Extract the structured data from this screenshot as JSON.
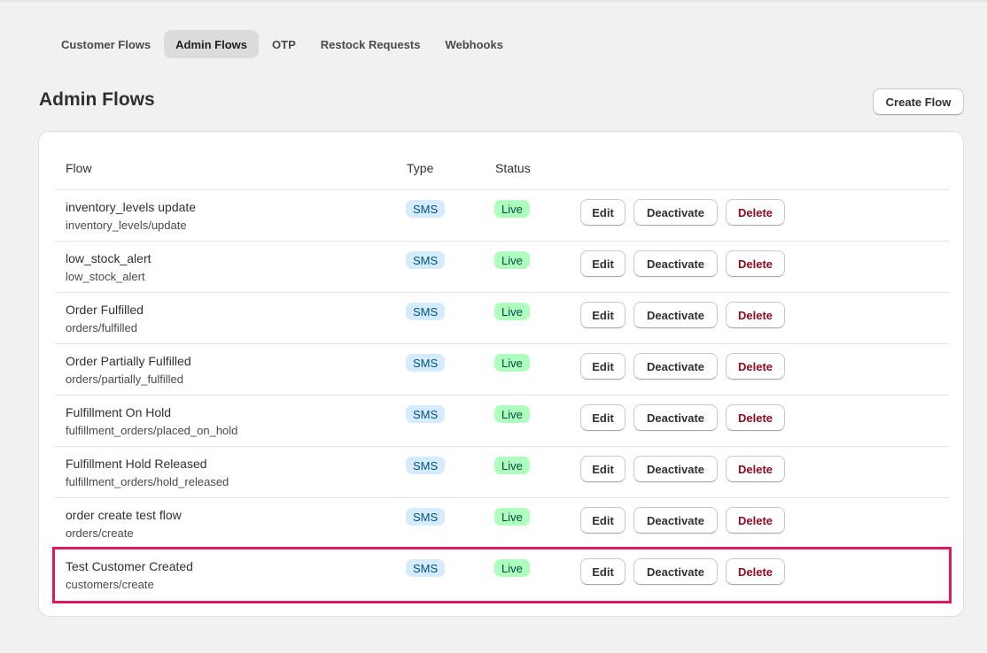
{
  "tabs": [
    {
      "label": "Customer Flows",
      "active": false
    },
    {
      "label": "Admin Flows",
      "active": true
    },
    {
      "label": "OTP",
      "active": false
    },
    {
      "label": "Restock Requests",
      "active": false
    },
    {
      "label": "Webhooks",
      "active": false
    }
  ],
  "page": {
    "title": "Admin Flows",
    "create_button": "Create Flow"
  },
  "table": {
    "headers": {
      "flow": "Flow",
      "type": "Type",
      "status": "Status"
    },
    "actions": {
      "edit": "Edit",
      "deactivate": "Deactivate",
      "delete": "Delete"
    },
    "rows": [
      {
        "name": "inventory_levels update",
        "topic": "inventory_levels/update",
        "type": "SMS",
        "status": "Live"
      },
      {
        "name": "low_stock_alert",
        "topic": "low_stock_alert",
        "type": "SMS",
        "status": "Live"
      },
      {
        "name": "Order Fulfilled",
        "topic": "orders/fulfilled",
        "type": "SMS",
        "status": "Live"
      },
      {
        "name": "Order Partially Fulfilled",
        "topic": "orders/partially_fulfilled",
        "type": "SMS",
        "status": "Live"
      },
      {
        "name": "Fulfillment On Hold",
        "topic": "fulfillment_orders/placed_on_hold",
        "type": "SMS",
        "status": "Live"
      },
      {
        "name": "Fulfillment Hold Released",
        "topic": "fulfillment_orders/hold_released",
        "type": "SMS",
        "status": "Live"
      },
      {
        "name": "order create test flow",
        "topic": "orders/create",
        "type": "SMS",
        "status": "Live"
      },
      {
        "name": "Test Customer Created",
        "topic": "customers/create",
        "type": "SMS",
        "status": "Live",
        "highlighted": true
      }
    ]
  },
  "colors": {
    "background": "#f1f1f1",
    "sms_badge": "#d5ebff",
    "live_badge": "#affebf",
    "delete_text": "#8e0b21",
    "highlight_outline": "#e0185f"
  }
}
